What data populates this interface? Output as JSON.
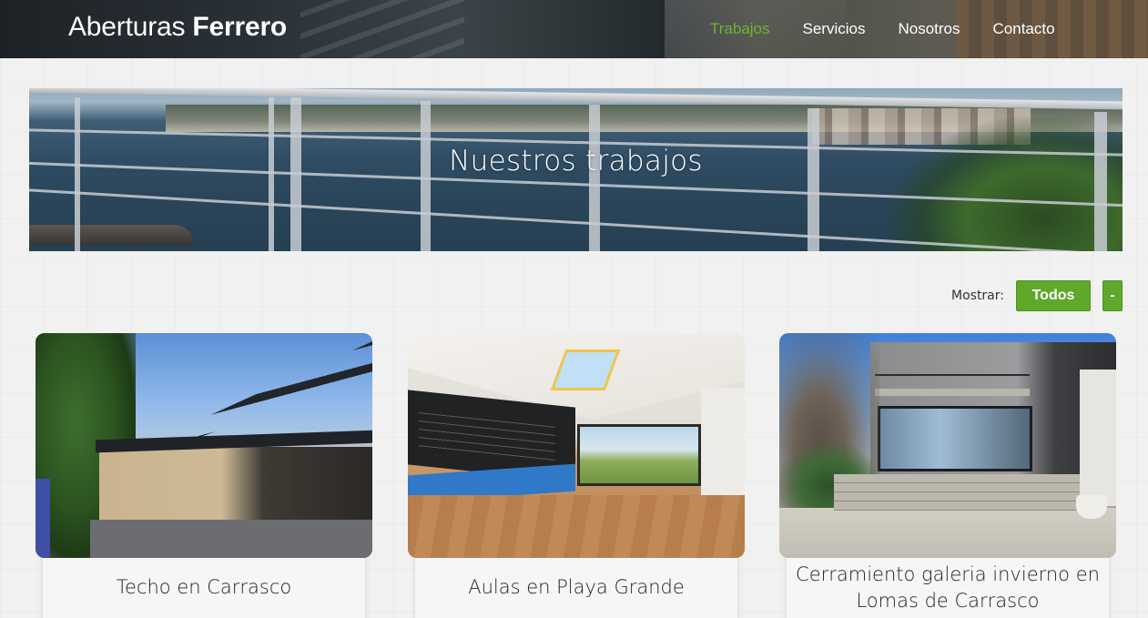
{
  "brand": {
    "first": "Aberturas",
    "second": "Ferrero"
  },
  "nav": {
    "items": [
      {
        "label": "Trabajos",
        "active": true
      },
      {
        "label": "Servicios",
        "active": false
      },
      {
        "label": "Nosotros",
        "active": false
      },
      {
        "label": "Contacto",
        "active": false
      }
    ]
  },
  "hero": {
    "title": "Nuestros trabajos"
  },
  "filter": {
    "label": "Mostrar:",
    "all_label": "Todos",
    "minus_label": "-"
  },
  "cards": [
    {
      "title": "Techo en Carrasco"
    },
    {
      "title": "Aulas en Playa Grande"
    },
    {
      "title": "Cerramiento galeria invierno en Lomas de Carrasco"
    }
  ],
  "colors": {
    "accent": "#6fb52c",
    "button": "#5fa82a",
    "background": "#f1f1f1"
  }
}
